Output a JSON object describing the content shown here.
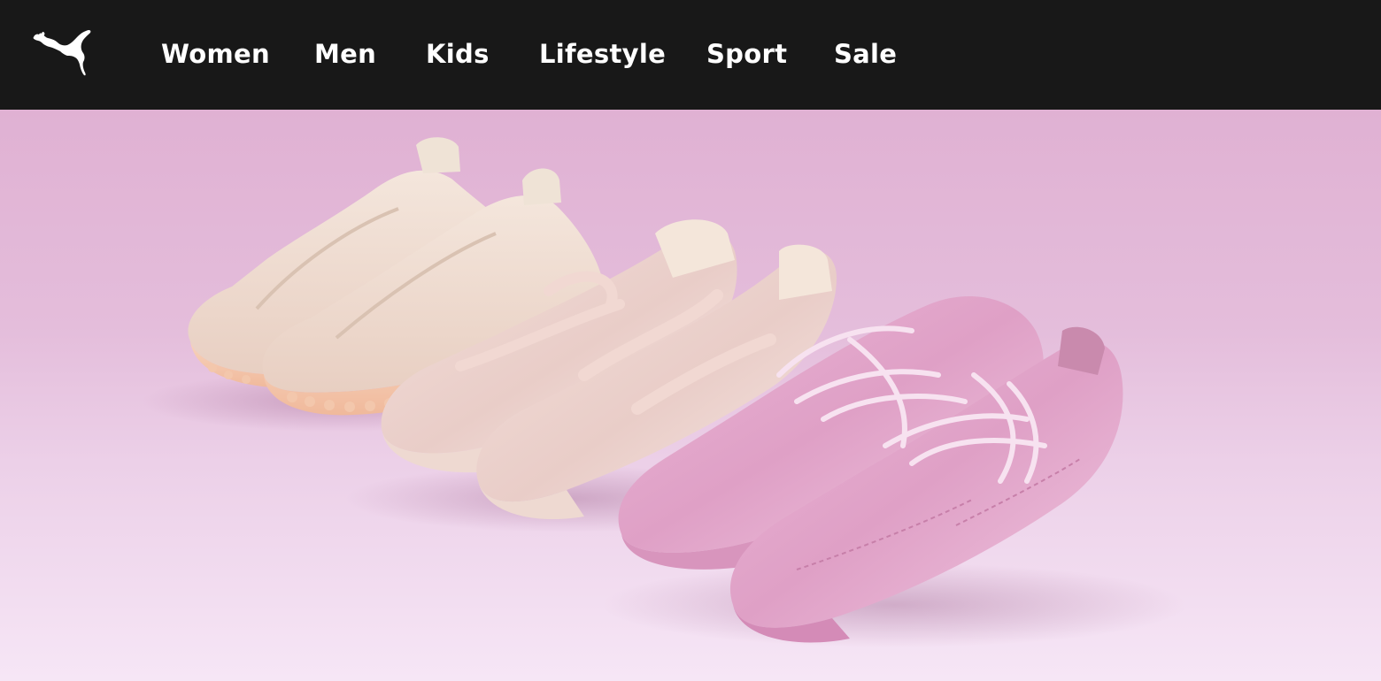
{
  "header": {
    "brand": "PUMA",
    "logo_icon": "puma-cat-logo-icon",
    "nav": [
      {
        "id": "women",
        "label": "Women"
      },
      {
        "id": "men",
        "label": "Men"
      },
      {
        "id": "kids",
        "label": "Kids"
      },
      {
        "id": "lifestyle",
        "label": "Lifestyle"
      },
      {
        "id": "sport",
        "label": "Sport"
      },
      {
        "id": "sale",
        "label": "Sale"
      }
    ]
  },
  "colors": {
    "header_bg": "#181818",
    "nav_text": "#ffffff",
    "hero_bg_top": "#e0b1d3",
    "hero_bg_bottom": "#f6e6f6"
  },
  "hero": {
    "image": "three pairs of pastel pink women's sneakers and ballet flats on a pink backdrop"
  }
}
